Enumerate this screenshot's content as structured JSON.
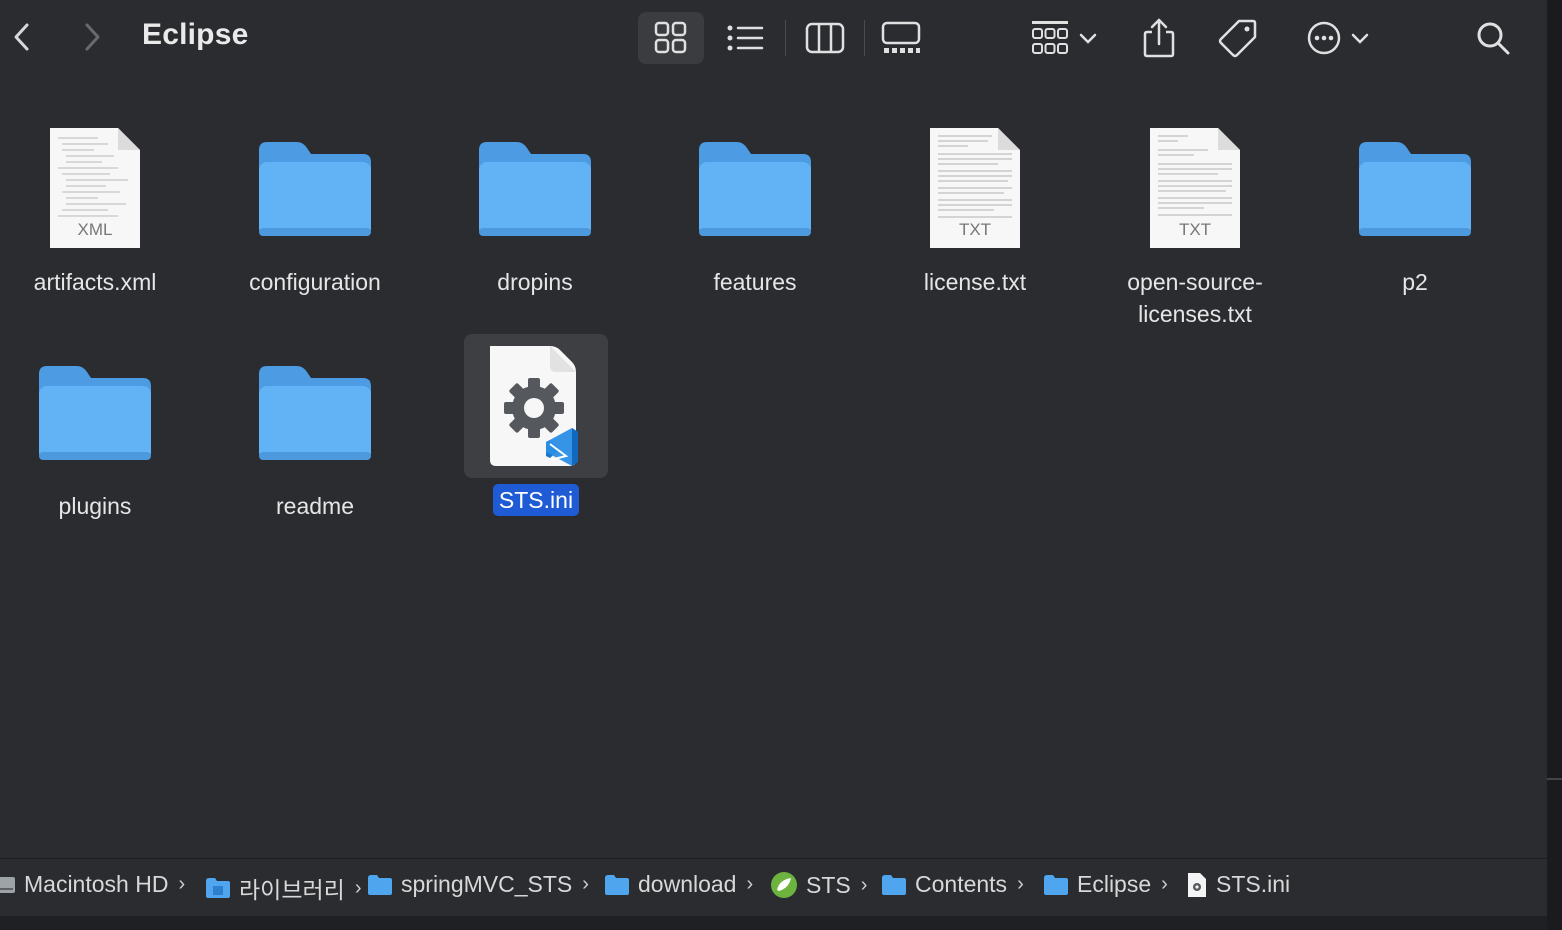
{
  "window": {
    "title": "Eclipse"
  },
  "toolbar": {
    "back": "‹",
    "forward": "›",
    "views": [
      "icon-view",
      "list-view",
      "column-view",
      "gallery-view"
    ],
    "actions": [
      "group-by",
      "share",
      "tags",
      "more",
      "search"
    ]
  },
  "files": [
    {
      "name": "artifacts.xml",
      "kind": "xml",
      "badge": "XML"
    },
    {
      "name": "configuration",
      "kind": "folder"
    },
    {
      "name": "dropins",
      "kind": "folder"
    },
    {
      "name": "features",
      "kind": "folder"
    },
    {
      "name": "license.txt",
      "kind": "txt",
      "badge": "TXT"
    },
    {
      "name": "open-source-licenses.txt",
      "line1": "open-source-",
      "line2": "licenses.txt",
      "kind": "txt",
      "badge": "TXT"
    },
    {
      "name": "p2",
      "kind": "folder"
    },
    {
      "name": "plugins",
      "kind": "folder"
    },
    {
      "name": "readme",
      "kind": "folder"
    },
    {
      "name": "STS.ini",
      "kind": "ini",
      "selected": true
    }
  ],
  "pathbar": [
    {
      "label": "Macintosh HD",
      "icon": "disk-icon"
    },
    {
      "label": "라이브러리",
      "icon": "library-folder-icon"
    },
    {
      "label": "springMVC_STS",
      "icon": "folder-icon"
    },
    {
      "label": "download",
      "icon": "folder-icon"
    },
    {
      "label": "STS",
      "icon": "spring-icon"
    },
    {
      "label": "Contents",
      "icon": "folder-icon"
    },
    {
      "label": "Eclipse",
      "icon": "folder-icon"
    },
    {
      "label": "STS.ini",
      "icon": "ini-file-icon"
    }
  ],
  "colors": {
    "background": "#2b2c30",
    "folder": "#5aaef0",
    "selection": "#1f5bd4"
  }
}
